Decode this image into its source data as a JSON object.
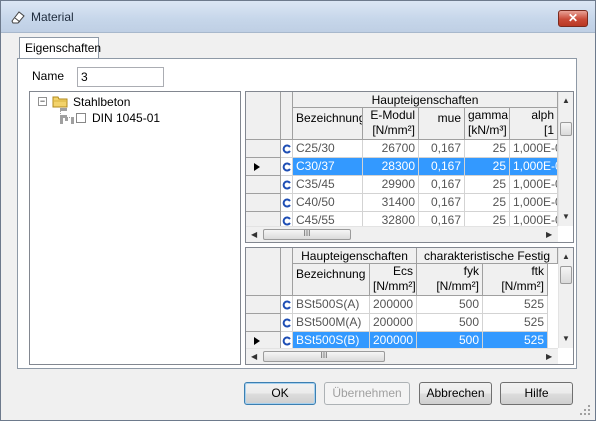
{
  "window": {
    "title": "Material",
    "close_glyph": "✕"
  },
  "tabs": [
    {
      "label": "Eigenschaften"
    }
  ],
  "name_field": {
    "label": "Name",
    "value": "3"
  },
  "tree": {
    "root": {
      "label": "Stahlbeton",
      "toggle": "−",
      "icon": "folder-icon"
    },
    "child": {
      "label": "DIN 1045-01",
      "icon": "node-icon"
    }
  },
  "concrete_grid": {
    "group_header": "Haupteigenschaften",
    "columns": [
      {
        "label": "Bezeichnung",
        "unit": ""
      },
      {
        "label": "E-Modul",
        "unit": "[N/mm²]"
      },
      {
        "label": "mue",
        "unit": ""
      },
      {
        "label": "gamma",
        "unit": "[kN/m³]"
      },
      {
        "label": "alph",
        "unit": "[1"
      }
    ],
    "rows": [
      {
        "name": "C25/30",
        "emodul": "26700",
        "mue": "0,167",
        "gamma": "25",
        "alpha": "1,000E-0"
      },
      {
        "name": "C30/37",
        "emodul": "28300",
        "mue": "0,167",
        "gamma": "25",
        "alpha": "1,000E-0"
      },
      {
        "name": "C35/45",
        "emodul": "29900",
        "mue": "0,167",
        "gamma": "25",
        "alpha": "1,000E-0"
      },
      {
        "name": "C40/50",
        "emodul": "31400",
        "mue": "0,167",
        "gamma": "25",
        "alpha": "1,000E-0"
      },
      {
        "name": "C45/55",
        "emodul": "32800",
        "mue": "0,167",
        "gamma": "25",
        "alpha": "1,000E-0"
      }
    ],
    "selected_row": 1,
    "hscroll_thumb_label": "III"
  },
  "steel_grid": {
    "group_header_1": "Haupteigenschaften",
    "group_header_2": "charakteristische Festig",
    "columns": [
      {
        "label": "Bezeichnung",
        "unit": ""
      },
      {
        "label": "Ecs",
        "unit": "[N/mm²]"
      },
      {
        "label": "fyk",
        "unit": "[N/mm²]"
      },
      {
        "label": "ftk",
        "unit": "[N/mm²]"
      }
    ],
    "rows": [
      {
        "name": "BSt500S(A)",
        "ecs": "200000",
        "fyk": "500",
        "ftk": "525"
      },
      {
        "name": "BSt500M(A)",
        "ecs": "200000",
        "fyk": "500",
        "ftk": "525"
      },
      {
        "name": "BSt500S(B)",
        "ecs": "200000",
        "fyk": "500",
        "ftk": "525"
      }
    ],
    "selected_row": 2,
    "hscroll_thumb_label": "III"
  },
  "buttons": {
    "ok": "OK",
    "apply": "Übernehmen",
    "cancel": "Abbrechen",
    "help": "Hilfe"
  },
  "colors": {
    "selection": "#3399ff",
    "row_icon": "#1f4fb5"
  }
}
